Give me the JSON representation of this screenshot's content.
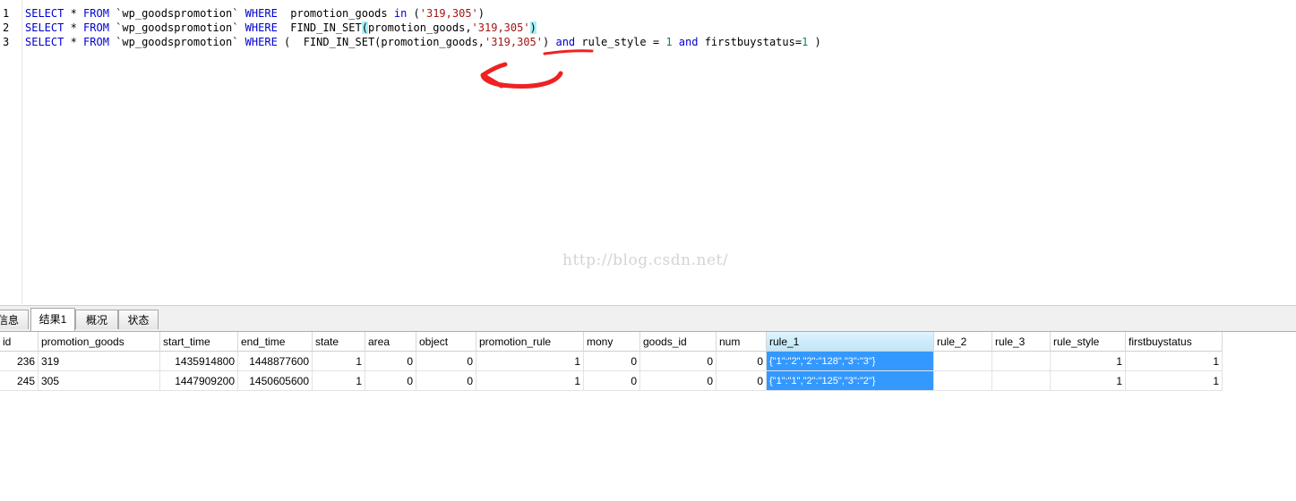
{
  "editor": {
    "line_numbers": [
      "1",
      "2",
      "3"
    ],
    "lines": [
      [
        {
          "t": "SELECT",
          "c": "kw"
        },
        {
          "t": " * "
        },
        {
          "t": "FROM",
          "c": "kw"
        },
        {
          "t": " `wp_goodspromotion` "
        },
        {
          "t": "WHERE",
          "c": "kw"
        },
        {
          "t": "  promotion_goods "
        },
        {
          "t": "in",
          "c": "kw"
        },
        {
          "t": " ("
        },
        {
          "t": "'319,305'",
          "c": "str"
        },
        {
          "t": ")"
        }
      ],
      [
        {
          "t": "SELECT",
          "c": "kw"
        },
        {
          "t": " * "
        },
        {
          "t": "FROM",
          "c": "kw"
        },
        {
          "t": " `wp_goodspromotion` "
        },
        {
          "t": "WHERE",
          "c": "kw"
        },
        {
          "t": "  FIND_IN_SET"
        },
        {
          "t": "(",
          "c": "br-hl"
        },
        {
          "t": "promotion_goods,"
        },
        {
          "t": "'319,305'",
          "c": "str"
        },
        {
          "t": ")",
          "c": "br-hl"
        }
      ],
      [
        {
          "t": "SELECT",
          "c": "kw"
        },
        {
          "t": " * "
        },
        {
          "t": "FROM",
          "c": "kw"
        },
        {
          "t": " `wp_goodspromotion` "
        },
        {
          "t": "WHERE",
          "c": "kw"
        },
        {
          "t": " (  FIND_IN_SET(promotion_goods,"
        },
        {
          "t": "'319,305'",
          "c": "str"
        },
        {
          "t": ") "
        },
        {
          "t": "and",
          "c": "kw"
        },
        {
          "t": " rule_style = "
        },
        {
          "t": "1",
          "c": "num"
        },
        {
          "t": " "
        },
        {
          "t": "and",
          "c": "kw"
        },
        {
          "t": " firstbuystatus="
        },
        {
          "t": "1",
          "c": "num"
        },
        {
          "t": " )"
        }
      ]
    ],
    "watermark": "http://blog.csdn.net/",
    "annotation_color": "#ee2222"
  },
  "tabs": [
    {
      "label": "信息",
      "active": false
    },
    {
      "label": "结果1",
      "active": true
    },
    {
      "label": "概况",
      "active": false
    },
    {
      "label": "状态",
      "active": false
    }
  ],
  "grid": {
    "columns": [
      "id",
      "promotion_goods",
      "start_time",
      "end_time",
      "state",
      "area",
      "object",
      "promotion_rule",
      "mony",
      "goods_id",
      "num",
      "rule_1",
      "rule_2",
      "rule_3",
      "rule_style",
      "firstbuystatus"
    ],
    "selected_column": "rule_1",
    "rows": [
      [
        "236",
        "319",
        "1435914800",
        "1448877600",
        "1",
        "0",
        "0",
        "1",
        "0",
        "0",
        "0",
        "{\"1\":\"2\",\"2\":\"128\",\"3\":\"3\"}",
        "",
        "",
        "1",
        "1"
      ],
      [
        "245",
        "305",
        "1447909200",
        "1450605600",
        "1",
        "0",
        "0",
        "1",
        "0",
        "0",
        "0",
        "{\"1\":\"1\",\"2\":\"125\",\"3\":\"2\"}",
        "",
        "",
        "1",
        "1"
      ]
    ],
    "highlight_color": "#3399ff"
  }
}
